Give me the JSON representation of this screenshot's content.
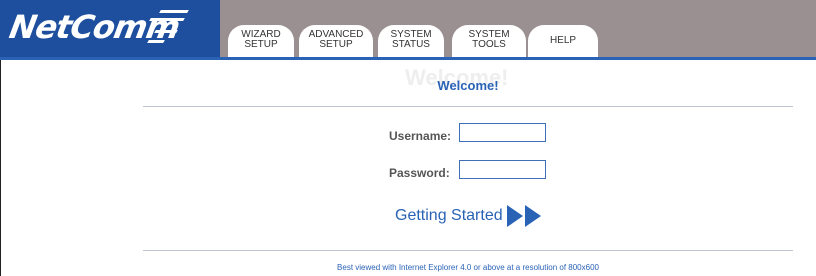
{
  "brand": {
    "logo_text": "NetComm"
  },
  "nav": {
    "tabs": [
      {
        "id": "wizard",
        "label": "WIZARD\nSETUP"
      },
      {
        "id": "advanced",
        "label": "ADVANCED\nSETUP"
      },
      {
        "id": "status",
        "label": "SYSTEM\nSTATUS"
      },
      {
        "id": "tools",
        "label": "SYSTEM\nTOOLS"
      },
      {
        "id": "help",
        "label": "HELP"
      }
    ]
  },
  "main": {
    "welcome_title": "Welcome!",
    "username_label": "Username:",
    "username_value": "",
    "password_label": "Password:",
    "password_value": "",
    "getting_started_label": "Getting Started"
  },
  "footer": {
    "note": "Best viewed with Internet Explorer 4.0 or above at a resolution of 800x600"
  },
  "colors": {
    "accent_blue": "#2a63b6",
    "header_gray": "#9a8f91",
    "logo_blue": "#1d4f9e"
  },
  "icons": {
    "getting_started_arrow": "double-right-arrow-icon"
  }
}
